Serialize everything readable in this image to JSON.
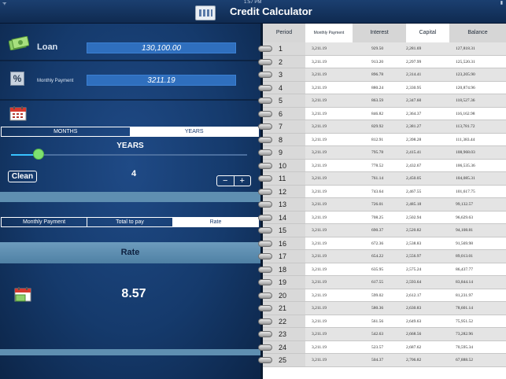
{
  "status": {
    "left": "ᯤ",
    "time": "1:57 PM",
    "right": "▮"
  },
  "app": {
    "title": "Credit Calculator"
  },
  "loan": {
    "label": "Loan",
    "value": "130,100.00"
  },
  "monthly": {
    "label": "Monthly Payment",
    "value": "3211.19"
  },
  "period_toggle": {
    "options": [
      "MONTHS",
      "YEARS"
    ],
    "selected": "YEARS"
  },
  "years": {
    "title": "YEARS",
    "value": "4",
    "slider_fraction": 0.1
  },
  "clean_label": "Clean",
  "stepper": {
    "minus": "−",
    "plus": "+"
  },
  "calc_toggle": {
    "options": [
      "Monthly Payment",
      "Total to pay",
      "Rate"
    ],
    "selected": "Rate"
  },
  "rate": {
    "title": "Rate",
    "value": "8.57"
  },
  "table": {
    "headers": [
      "Period",
      "Monthly Payment",
      "Interest",
      "Capital",
      "Balance"
    ],
    "rows": [
      [
        "1",
        "3,211.19",
        "929.50",
        "2,281.69",
        "127,818.31"
      ],
      [
        "2",
        "3,211.19",
        "913.20",
        "2,297.99",
        "125,520.31"
      ],
      [
        "3",
        "3,211.19",
        "896.78",
        "2,314.41",
        "123,205.90"
      ],
      [
        "4",
        "3,211.19",
        "880.24",
        "2,330.95",
        "120,874.96"
      ],
      [
        "5",
        "3,211.19",
        "863.59",
        "2,347.60",
        "118,527.36"
      ],
      [
        "6",
        "3,211.19",
        "846.82",
        "2,364.37",
        "116,162.98"
      ],
      [
        "7",
        "3,211.19",
        "829.92",
        "2,381.27",
        "113,781.72"
      ],
      [
        "8",
        "3,211.19",
        "812.91",
        "2,398.28",
        "111,383.44"
      ],
      [
        "9",
        "3,211.19",
        "795.78",
        "2,415.41",
        "108,968.03"
      ],
      [
        "10",
        "3,211.19",
        "778.52",
        "2,432.67",
        "106,535.36"
      ],
      [
        "11",
        "3,211.19",
        "761.14",
        "2,450.05",
        "104,085.31"
      ],
      [
        "12",
        "3,211.19",
        "743.64",
        "2,467.55",
        "101,617.75"
      ],
      [
        "13",
        "3,211.19",
        "726.01",
        "2,485.18",
        "99,132.57"
      ],
      [
        "14",
        "3,211.19",
        "708.25",
        "2,502.94",
        "96,629.63"
      ],
      [
        "15",
        "3,211.19",
        "690.37",
        "2,520.82",
        "94,108.81"
      ],
      [
        "16",
        "3,211.19",
        "672.36",
        "2,538.83",
        "91,569.98"
      ],
      [
        "17",
        "3,211.19",
        "654.22",
        "2,556.97",
        "89,013.01"
      ],
      [
        "18",
        "3,211.19",
        "635.95",
        "2,575.24",
        "86,437.77"
      ],
      [
        "19",
        "3,211.19",
        "617.55",
        "2,593.64",
        "83,844.14"
      ],
      [
        "20",
        "3,211.19",
        "599.02",
        "2,612.17",
        "81,231.97"
      ],
      [
        "21",
        "3,211.19",
        "580.36",
        "2,630.83",
        "78,601.14"
      ],
      [
        "22",
        "3,211.19",
        "561.56",
        "2,649.63",
        "75,951.52"
      ],
      [
        "23",
        "3,211.19",
        "542.63",
        "2,668.56",
        "73,282.96"
      ],
      [
        "24",
        "3,211.19",
        "523.57",
        "2,687.62",
        "70,595.34"
      ],
      [
        "25",
        "3,211.19",
        "504.37",
        "2,706.82",
        "67,888.52"
      ]
    ]
  },
  "colors": {
    "accent_field": "#2f6fbe",
    "panel": "#153a6c",
    "slider_knob": "#7ee070"
  }
}
